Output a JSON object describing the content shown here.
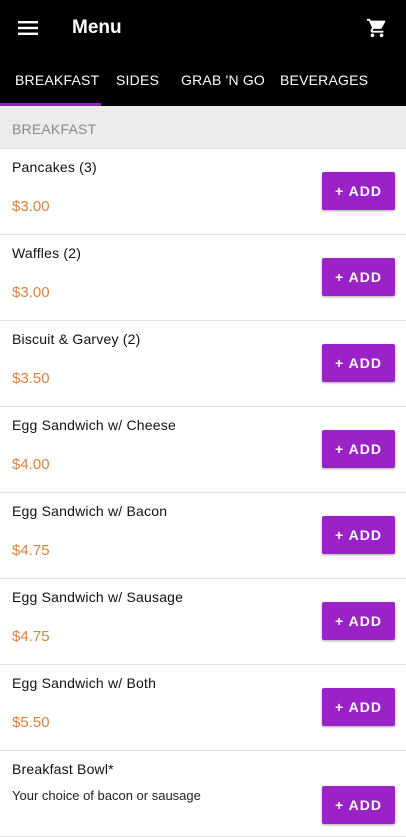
{
  "app_bar": {
    "title": "Menu",
    "menu_icon": "hamburger-menu-icon",
    "cart_icon": "shopping-cart-icon"
  },
  "tabs": [
    {
      "label": "BREAKFAST",
      "selected": true
    },
    {
      "label": "SIDES",
      "selected": false
    },
    {
      "label": "GRAB 'N GO",
      "selected": false
    },
    {
      "label": "BEVERAGES",
      "selected": false
    }
  ],
  "section": {
    "header": "BREAKFAST"
  },
  "items": [
    {
      "name": "Pancakes (3)",
      "price": "$3.00",
      "add_label": "+ ADD"
    },
    {
      "name": "Waffles (2)",
      "price": "$3.00",
      "add_label": "+ ADD"
    },
    {
      "name": "Biscuit & Garvey (2)",
      "price": "$3.50",
      "add_label": "+ ADD"
    },
    {
      "name": "Egg Sandwich w/ Cheese",
      "price": "$4.00",
      "add_label": "+ ADD"
    },
    {
      "name": "Egg Sandwich w/ Bacon",
      "price": "$4.75",
      "add_label": "+ ADD"
    },
    {
      "name": "Egg Sandwich w/ Sausage",
      "price": "$4.75",
      "add_label": "+ ADD"
    },
    {
      "name": "Egg Sandwich w/ Both",
      "price": "$5.50",
      "add_label": "+ ADD"
    },
    {
      "name": "Breakfast Bowl*",
      "description": "Your choice of bacon or sausage",
      "add_label": "+ ADD"
    }
  ],
  "colors": {
    "app_bar": "#000000",
    "accent": "#9a22c6",
    "tab_indicator": "#8e24c0",
    "price": "#d9823f",
    "section_bg": "#ececec"
  }
}
